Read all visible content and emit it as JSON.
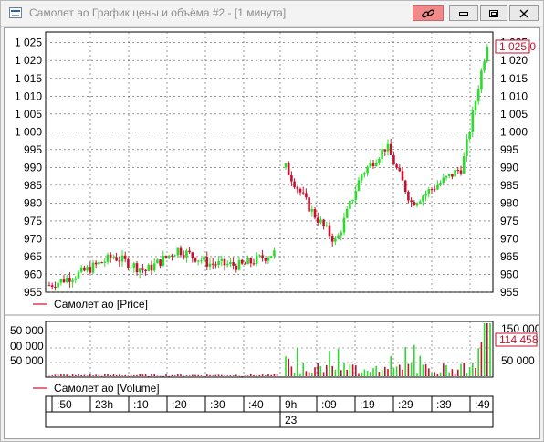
{
  "window": {
    "title": "Самолет ао График цены и объёма #2 - [1 минута]",
    "icons": {
      "app": "chart-window-icon",
      "link": "link-icon",
      "minimize": "minimize-icon",
      "restore": "restore-icon",
      "close": "close-icon"
    },
    "link_button_color": "#f08a8a"
  },
  "price_panel": {
    "legend": "Самолет ао [Price]",
    "current_value_label": "1 025,0",
    "up_color": "#2bdc2b",
    "down_color": "#c8102e"
  },
  "volume_panel": {
    "legend": "Самолет ао [Volume]",
    "current_value_label": "114 458"
  },
  "time_axis": {
    "minute_labels": [
      ":50",
      "23h",
      ":10",
      ":20",
      ":30",
      ":40",
      "9h",
      ":09",
      ":19",
      ":29",
      ":39",
      ":49"
    ],
    "day_label": "23"
  },
  "chart_data": [
    {
      "type": "candlestick",
      "title": "Самолет ао [Price]",
      "ylim": [
        955,
        1028
      ],
      "y_ticks": [
        "955",
        "960",
        "965",
        "970",
        "975",
        "980",
        "985",
        "990",
        "995",
        "1 000",
        "1 005",
        "1 010",
        "1 015",
        "1 020",
        "1 025"
      ],
      "grid": true,
      "x": [
        "22:50",
        "23:00",
        "23:10",
        "23:20",
        "23:30",
        "23:40",
        "09:00",
        "09:09",
        "09:19",
        "09:29",
        "09:39",
        "09:49"
      ],
      "close": [
        957,
        960.5,
        965,
        961,
        967,
        963,
        962.5,
        966,
        990,
        978,
        969,
        988,
        996,
        980,
        985,
        990,
        1025
      ],
      "last": 1025.0
    },
    {
      "type": "bar",
      "title": "Самолет ао [Volume]",
      "y_ticks_right": [
        "50 000",
        "100 000",
        "150 000"
      ],
      "y_ticks_left": [
        "50 000",
        "00 000",
        "50 000"
      ],
      "grid": true,
      "last": 114458
    }
  ]
}
